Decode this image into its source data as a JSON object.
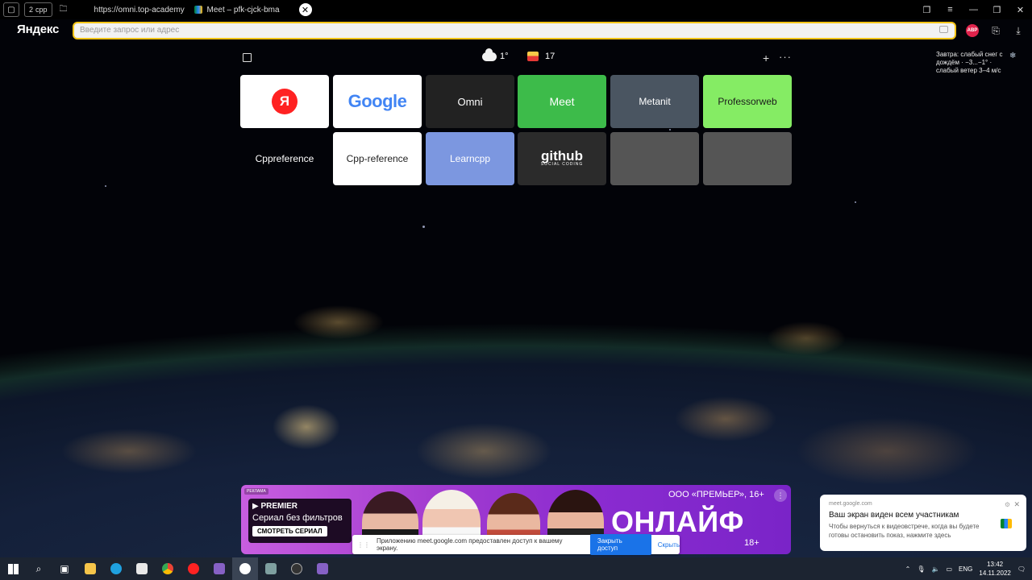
{
  "tabstrip": {
    "group_label": "cpp",
    "group_count": "2",
    "tabs": [
      {
        "title": "https://omni.top-academy",
        "favicon_color": "#c2185b"
      },
      {
        "title": "Meet – pfk-cjck-bma",
        "favicon_color": "#2684fc"
      }
    ]
  },
  "addressbar": {
    "logo": "Яндекс",
    "placeholder": "Введите запрос или адрес",
    "abp_badge": "ABP"
  },
  "widgets": {
    "temperature": "1°",
    "mail_count": "17",
    "forecast": "Завтра: слабый снег с дождём · −3...−1° · слабый ветер 3–4 м/с"
  },
  "tiles": [
    {
      "label": "Я",
      "bg": "#ffffff",
      "fg": "#ffffff",
      "kind": "yandex"
    },
    {
      "label": "Google",
      "bg": "#ffffff",
      "fg": "#4285f4",
      "kind": "google"
    },
    {
      "label": "Omni",
      "bg": "#222222",
      "fg": "#ffffff",
      "kind": "text"
    },
    {
      "label": "Meet",
      "bg": "#3dbb4a",
      "fg": "#ffffff",
      "kind": "text"
    },
    {
      "label": "Metanit",
      "bg": "#4a5561",
      "fg": "#ffffff",
      "kind": "text"
    },
    {
      "label": "Professorweb",
      "bg": "#85ec64",
      "fg": "#1b1b1b",
      "kind": "text"
    },
    {
      "label": "Cppreference",
      "bg": "transparent",
      "fg": "#ffffff",
      "kind": "text"
    },
    {
      "label": "Cpp-reference",
      "bg": "#ffffff",
      "fg": "#222222",
      "kind": "text"
    },
    {
      "label": "Learncpp",
      "bg": "#7c97e0",
      "fg": "#ffffff",
      "kind": "text"
    },
    {
      "label": "github",
      "sub": "SOCIAL CODING",
      "bg": "#2b2b2b",
      "fg": "#ffffff",
      "kind": "github"
    },
    {
      "label": "",
      "bg": "#555555",
      "fg": "#ffffff",
      "kind": "empty"
    },
    {
      "label": "",
      "bg": "#555555",
      "fg": "#ffffff",
      "kind": "empty"
    }
  ],
  "ad": {
    "tag": "РЕКЛАМА",
    "brand": "▶ PREMIER",
    "headline": "Сериал без фильтров",
    "cta": "СМОТРЕТЬ СЕРИАЛ",
    "company": "ООО «ПРЕМЬЕР», 16+",
    "title": "ОНЛАЙФ",
    "age": "18+"
  },
  "sharebar": {
    "message": "Приложению meet.google.com предоставлен доступ к вашему экрану.",
    "stop_label": "Закрыть доступ",
    "hide_label": "Скрыть"
  },
  "notification": {
    "source": "meet.google.com",
    "title": "Ваш экран виден всем участникам",
    "body": "Чтобы вернуться к видеовстрече, когда вы будете готовы остановить показ, нажмите здесь"
  },
  "taskbar": {
    "language": "ENG",
    "time": "13:42",
    "date": "14.11.2022"
  }
}
